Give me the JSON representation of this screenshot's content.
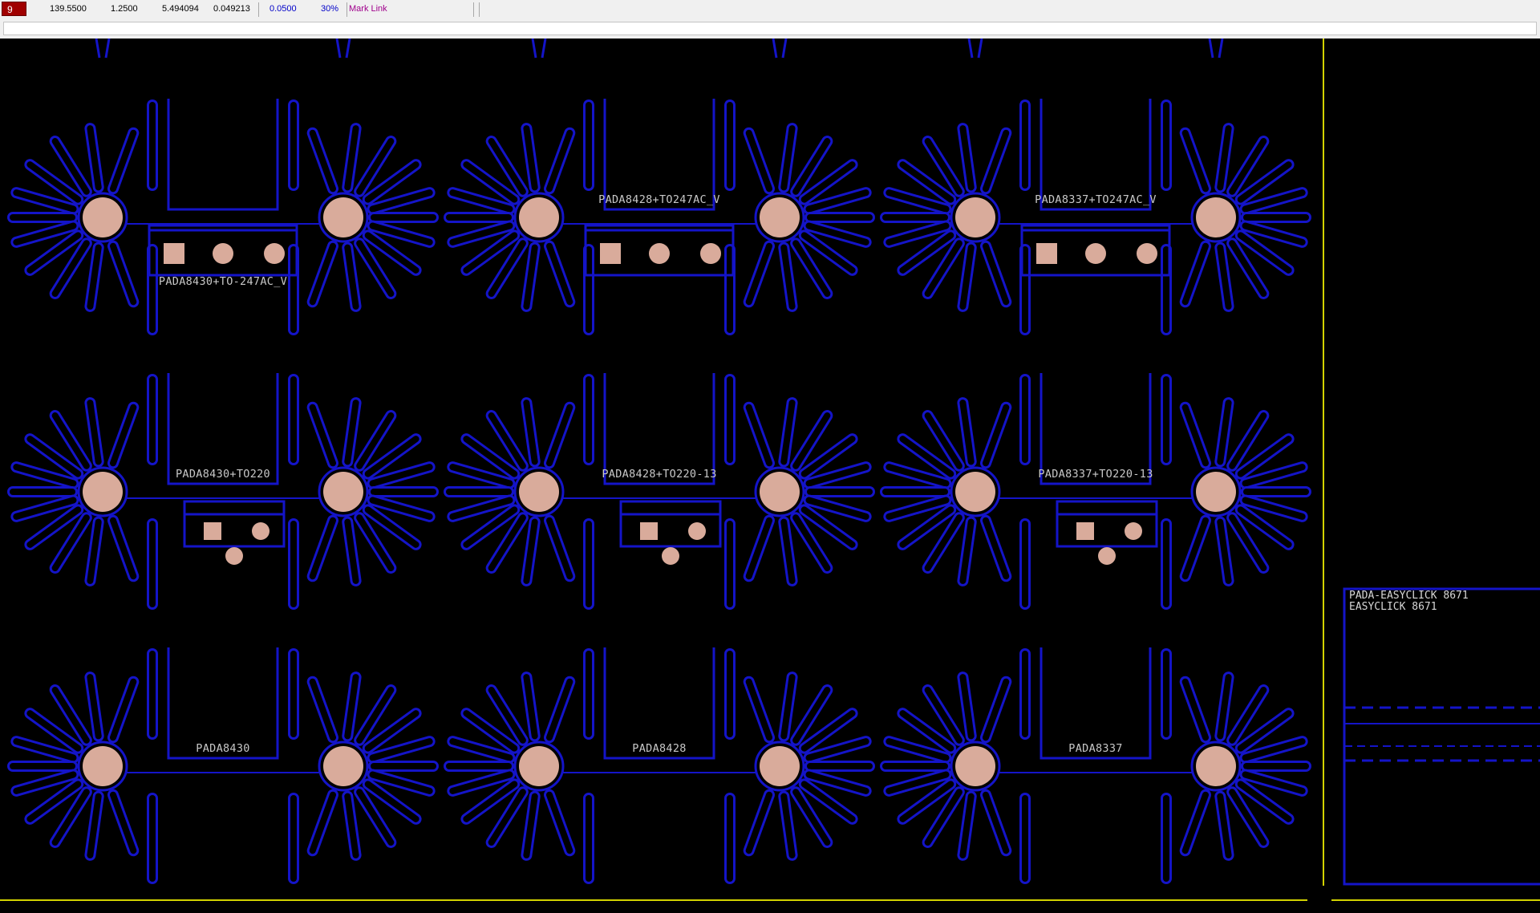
{
  "status": {
    "layer": "9",
    "x": "139.5500",
    "y": "1.2500",
    "dx": "5.494094",
    "dy": "0.049213",
    "grid": "0.0500",
    "zoom": "30%",
    "mode": "Mark Link"
  },
  "colors": {
    "outline": "#1414c8",
    "pad": "#d9ab9b",
    "boundary": "#d2d200",
    "label": "#c8c8c8"
  },
  "footprints": [
    {
      "label": "PADA8430+TO-247AC_V"
    },
    {
      "label": "PADA8428+TO247AC_V"
    },
    {
      "label": "PADA8337+TO247AC_V"
    },
    {
      "label": "PADA8430+TO220"
    },
    {
      "label": "PADA8428+TO220-13"
    },
    {
      "label": "PADA8337+TO220-13"
    },
    {
      "label": "PADA8430"
    },
    {
      "label": "PADA8428"
    },
    {
      "label": "PADA8337"
    }
  ],
  "side_panel": {
    "line1": "PADA-EASYCLICK 8671",
    "line2": "EASYCLICK 8671"
  }
}
